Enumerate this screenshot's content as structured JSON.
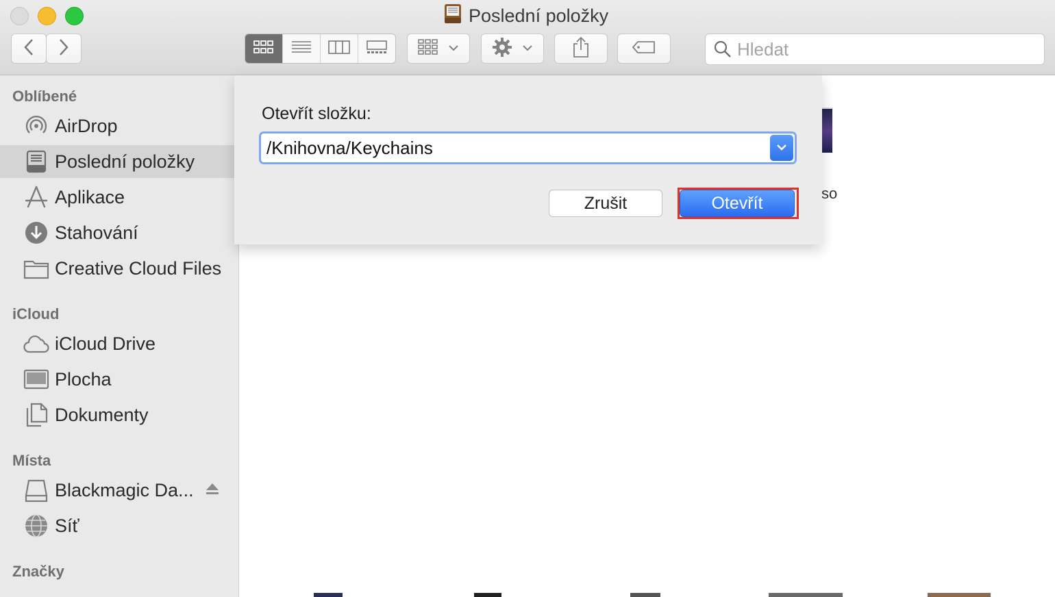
{
  "window": {
    "title": "Poslední položky",
    "controls": {
      "close": "close",
      "minimize": "minimize",
      "zoom": "zoom"
    }
  },
  "toolbar": {
    "back_icon": "chevron-left-icon",
    "forward_icon": "chevron-right-icon",
    "view_modes": [
      "icon-view-icon",
      "list-view-icon",
      "column-view-icon",
      "gallery-view-icon"
    ],
    "active_view": "icon-view-icon",
    "group_icon": "group-icon",
    "action_icon": "gear-icon",
    "share_icon": "share-icon",
    "tag_icon": "tag-icon",
    "search_placeholder": "Hledat"
  },
  "sidebar": {
    "sections": [
      {
        "title": "Oblíbené"
      },
      {
        "title": "iCloud"
      },
      {
        "title": "Místa"
      },
      {
        "title": "Značky"
      }
    ],
    "favorites": [
      {
        "label": "AirDrop",
        "icon": "airdrop-icon"
      },
      {
        "label": "Poslední položky",
        "icon": "recents-icon",
        "selected": true
      },
      {
        "label": "Aplikace",
        "icon": "applications-icon"
      },
      {
        "label": "Stahování",
        "icon": "download-icon"
      },
      {
        "label": "Creative Cloud Files",
        "icon": "folder-icon"
      }
    ],
    "icloud": [
      {
        "label": "iCloud Drive",
        "icon": "cloud-icon"
      },
      {
        "label": "Plocha",
        "icon": "desktop-icon"
      },
      {
        "label": "Dokumenty",
        "icon": "documents-icon"
      }
    ],
    "locations": [
      {
        "label": "Blackmagic Da...",
        "icon": "drive-icon",
        "eject": true
      },
      {
        "label": "Síť",
        "icon": "network-icon"
      }
    ]
  },
  "content": {
    "peek_text": "so"
  },
  "dialog": {
    "label": "Otevřít složku:",
    "path_value": "/Knihovna/Keychains",
    "cancel_label": "Zrušit",
    "open_label": "Otevřít",
    "highlight_color": "#e0322a"
  }
}
